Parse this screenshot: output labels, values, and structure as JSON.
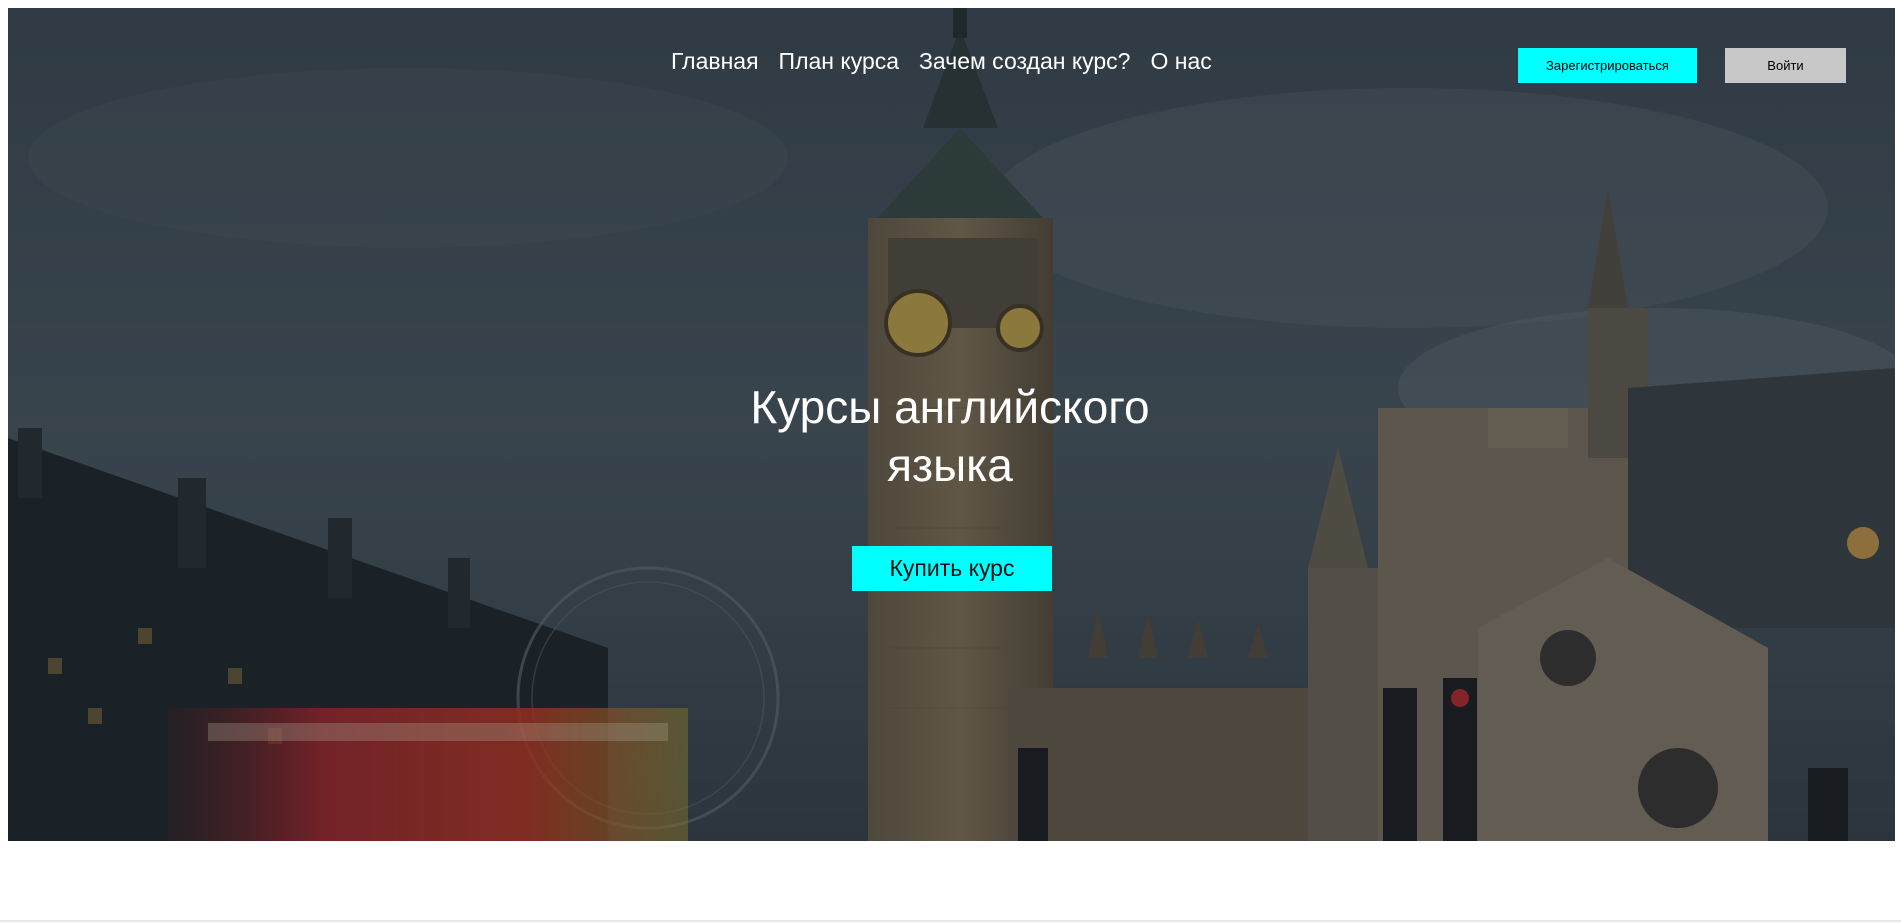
{
  "nav": {
    "items": [
      {
        "label": "Главная"
      },
      {
        "label": "План курса"
      },
      {
        "label": "Зачем создан курс?"
      },
      {
        "label": "О нас"
      }
    ]
  },
  "auth": {
    "register_label": "Зарегистрироваться",
    "login_label": "Войти"
  },
  "hero": {
    "title": "Курсы английского языка",
    "buy_label": "Купить курс"
  },
  "colors": {
    "accent": "#00ffff",
    "login_bg": "#c8c8c8",
    "text_light": "#ffffff"
  }
}
